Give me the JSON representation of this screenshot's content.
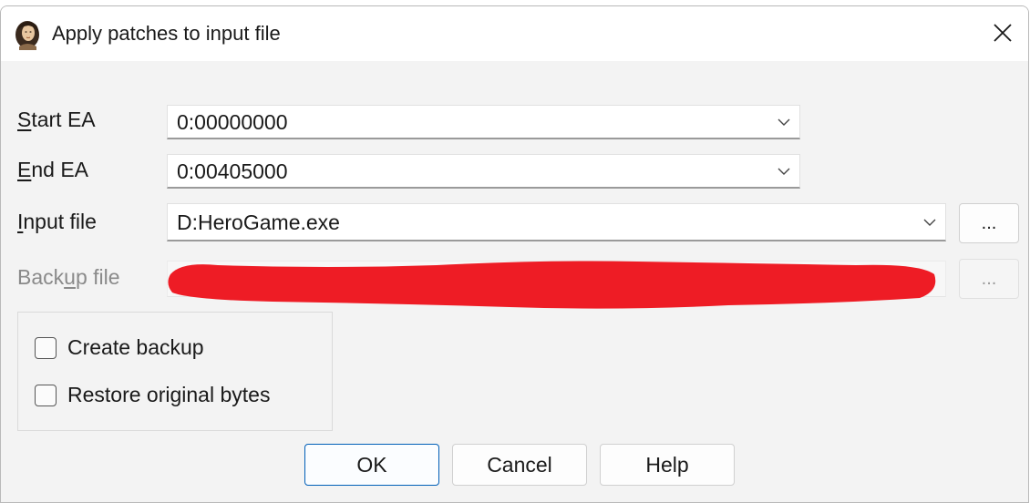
{
  "dialog": {
    "title": "Apply patches to input file",
    "icon": "ida-portrait-icon"
  },
  "fields": {
    "start_ea": {
      "label_underlined": "S",
      "label_rest": "tart EA",
      "value": "0:00000000"
    },
    "end_ea": {
      "label_underlined": "E",
      "label_rest": "nd EA",
      "value": "0:00405000"
    },
    "input_file": {
      "label_underlined": "I",
      "label_rest": "nput file",
      "value": "D:HeroGame.exe",
      "browse_label": "..."
    },
    "backup_file": {
      "label_pre": "Back",
      "label_underlined": "u",
      "label_rest": "p file",
      "value": "",
      "browse_label": "...",
      "redacted": true
    }
  },
  "options": {
    "create_backup": {
      "label": "Create backup",
      "checked": false
    },
    "restore_original": {
      "label": "Restore original bytes",
      "checked": false
    }
  },
  "buttons": {
    "ok": "OK",
    "cancel": "Cancel",
    "help": "Help"
  },
  "colors": {
    "accent": "#005fb8",
    "redaction": "#ee1c25"
  }
}
